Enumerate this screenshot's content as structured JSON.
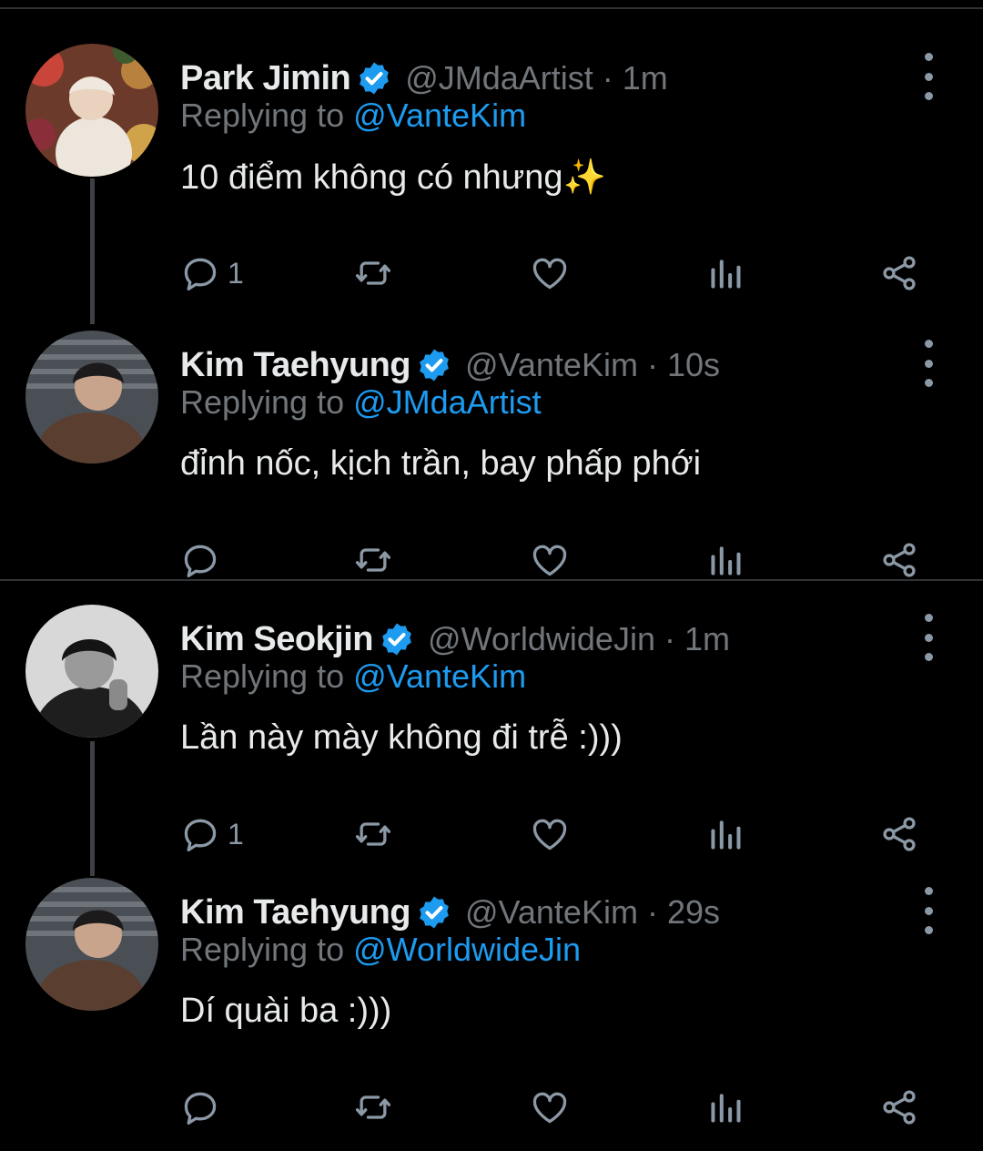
{
  "colors": {
    "background": "#000000",
    "text": "#e7e9ea",
    "muted": "#71767b",
    "accent": "#1d9bf0",
    "divider": "#2f3336",
    "icon": "#8b98a5"
  },
  "tweets": [
    {
      "name": "Park Jimin",
      "handle": "@JMdaArtist",
      "time": " · 1m",
      "replying_prefix": "Replying to ",
      "replying_to": "@VanteKim",
      "text": "10 điểm không có nhưng✨",
      "reply_count": "1",
      "icons": [
        "reply-icon",
        "retweet-icon",
        "like-icon",
        "analytics-icon",
        "share-icon",
        "more-icon"
      ]
    },
    {
      "name": "Kim Taehyung",
      "handle": "@VanteKim",
      "time": " · 10s",
      "replying_prefix": "Replying to ",
      "replying_to": "@JMdaArtist",
      "text": "đỉnh nốc, kịch trần, bay phấp phới",
      "reply_count": "",
      "icons": [
        "reply-icon",
        "retweet-icon",
        "like-icon",
        "analytics-icon",
        "share-icon",
        "more-icon"
      ]
    },
    {
      "name": "Kim Seokjin",
      "handle": "@WorldwideJin",
      "time": " · 1m",
      "replying_prefix": "Replying to ",
      "replying_to": "@VanteKim",
      "text": "Lần này mày không đi trễ :)))",
      "reply_count": "1",
      "icons": [
        "reply-icon",
        "retweet-icon",
        "like-icon",
        "analytics-icon",
        "share-icon",
        "more-icon"
      ]
    },
    {
      "name": "Kim Taehyung",
      "handle": "@VanteKim",
      "time": " · 29s",
      "replying_prefix": "Replying to ",
      "replying_to": "@WorldwideJin",
      "text": "Dí quài ba :)))",
      "reply_count": "",
      "icons": [
        "reply-icon",
        "retweet-icon",
        "like-icon",
        "analytics-icon",
        "share-icon",
        "more-icon"
      ]
    }
  ]
}
